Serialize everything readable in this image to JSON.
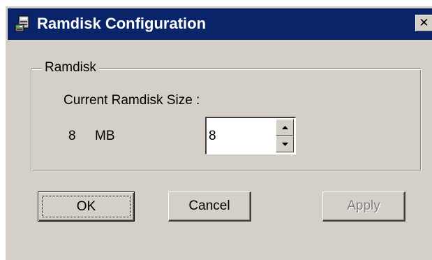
{
  "window": {
    "title": "Ramdisk Configuration",
    "icon": "ramdisk-app-icon",
    "close_glyph": "✕"
  },
  "group": {
    "label": "Ramdisk",
    "size_label": "Current Ramdisk Size :",
    "current_value": "8",
    "current_unit": "MB",
    "spin_value": "8"
  },
  "buttons": {
    "ok": "OK",
    "cancel": "Cancel",
    "apply": "Apply"
  },
  "colors": {
    "titlebar": "#0a246a",
    "face": "#d4d0c8",
    "disabled_text": "#808080"
  }
}
